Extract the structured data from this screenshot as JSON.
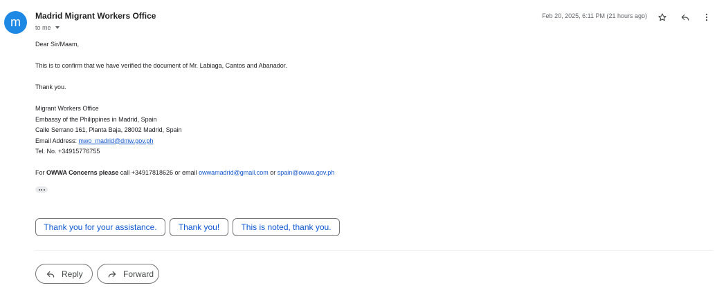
{
  "email": {
    "sender_initial": "m",
    "sender_name": "Madrid Migrant Workers Office",
    "to_label": "to me",
    "date": "Feb 20, 2025, 6:11 PM (21 hours ago)",
    "greeting": "Dear Sir/Maam,",
    "confirmation": "This is to confirm that we have verified the document of Mr. Labiaga, Cantos and Abanador.",
    "thanks": "Thank you.",
    "signature": {
      "line1": "Migrant Workers Office",
      "line2": "Embassy of the Philippines in Madrid, Spain",
      "line3": "Calle Serrano 161, Planta Baja, 28002 Madrid, Spain",
      "email_label": "Email Address: ",
      "email_link": "mwo_madrid@dmw.gov.ph",
      "tel": "Tel. No. +34915776755"
    },
    "owwa": {
      "prefix": "For ",
      "bold": "OWWA Concerns please",
      "middle": " call +34917818626 or email ",
      "email1": "owwamadrid@gmail.com",
      "or": " or ",
      "email2": "spain@owwa.gov.ph"
    }
  },
  "smart_replies": [
    "Thank you for your assistance.",
    "Thank you!",
    "This is noted, thank you."
  ],
  "actions": {
    "reply": "Reply",
    "forward": "Forward"
  },
  "icons": {
    "star": "star-icon",
    "reply": "reply-icon",
    "more": "more-vert-icon",
    "forward": "forward-icon",
    "show_trimmed": "ellipsis-icon",
    "caret": "chevron-down-icon"
  },
  "colors": {
    "avatar": "#1e88e5",
    "link": "#1155cc",
    "smart_reply_text": "#0b57d0"
  }
}
